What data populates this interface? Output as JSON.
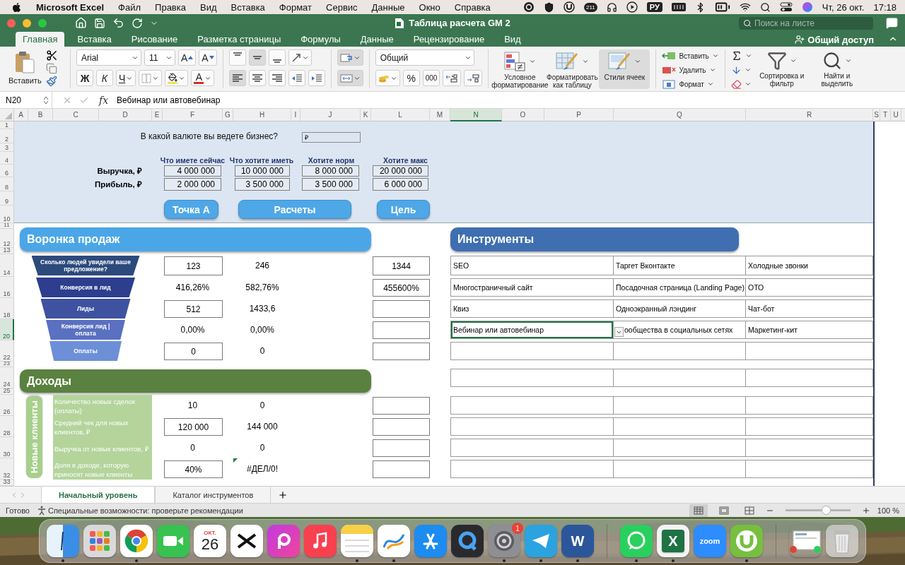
{
  "menubar": {
    "app": "Microsoft Excel",
    "menus": [
      "Файл",
      "Правка",
      "Вид",
      "Вставка",
      "Формат",
      "Сервис",
      "Данные",
      "Окно",
      "Справка"
    ],
    "notifications": "211",
    "input_source": "РУ",
    "date": "Чт, 26 окт.",
    "time": "17:18"
  },
  "window": {
    "title": "Таблица расчета GM 2",
    "search": {
      "placeholder": "Поиск на листе"
    }
  },
  "ribbon_tabs": [
    {
      "label": "Главная",
      "selected": true
    },
    {
      "label": "Вставка",
      "selected": false
    },
    {
      "label": "Рисование",
      "selected": false
    },
    {
      "label": "Разметка страницы",
      "selected": false
    },
    {
      "label": "Формулы",
      "selected": false
    },
    {
      "label": "Данные",
      "selected": false
    },
    {
      "label": "Рецензирование",
      "selected": false
    },
    {
      "label": "Вид",
      "selected": false
    }
  ],
  "share": "Общий доступ",
  "ribbon": {
    "paste": "Вставить",
    "font": {
      "name": "Arial",
      "size": "11",
      "grow": "A",
      "shrink": "A",
      "bold": "Ж",
      "italic": "К",
      "underline": "Ч",
      "font_color_letter": "A"
    },
    "vertical_align": [
      {
        "selected": false
      },
      {
        "selected": true
      },
      {
        "selected": false
      }
    ],
    "horizontal_align": [
      {
        "selected": true
      },
      {
        "selected": false
      },
      {
        "selected": false
      }
    ],
    "wrap_text": {
      "selected": true
    },
    "merge": {
      "selected": true
    },
    "number": {
      "format": "Общий",
      "percent": "%",
      "thousands": "000"
    },
    "styles": [
      {
        "kind": "conditional",
        "label": "Условное форматирование",
        "selected": false
      },
      {
        "kind": "table",
        "label": "Форматировать как таблицу",
        "selected": false
      },
      {
        "kind": "cell_styles",
        "label": "Стили ячеек",
        "selected": true
      }
    ],
    "cells": [
      {
        "kind": "insert",
        "label": "Вставить"
      },
      {
        "kind": "delete",
        "label": "Удалить"
      },
      {
        "kind": "format",
        "label": "Формат"
      }
    ],
    "editing": [
      {
        "kind": "sort",
        "label": "Сортировка и фильтр"
      },
      {
        "kind": "find",
        "label": "Найти и выделить"
      }
    ]
  },
  "formula_bar": {
    "name_box": "N20",
    "fx": "fx",
    "value": "Вебинар или автовебинар"
  },
  "columns": [
    {
      "label": "A",
      "selected": false
    },
    {
      "label": "B",
      "selected": false
    },
    {
      "label": "C",
      "selected": false
    },
    {
      "label": "D",
      "selected": false
    },
    {
      "label": "E",
      "selected": false
    },
    {
      "label": "F",
      "selected": false
    },
    {
      "label": "G",
      "selected": false
    },
    {
      "label": "H",
      "selected": false
    },
    {
      "label": "I",
      "selected": false
    },
    {
      "label": "J",
      "selected": false
    },
    {
      "label": "K",
      "selected": false
    },
    {
      "label": "L",
      "selected": false
    },
    {
      "label": "M",
      "selected": false
    },
    {
      "label": "N",
      "selected": true
    },
    {
      "label": "O",
      "selected": false
    },
    {
      "label": "P",
      "selected": false
    },
    {
      "label": "Q",
      "selected": false
    },
    {
      "label": "R",
      "selected": false
    },
    {
      "label": "S",
      "selected": false
    },
    {
      "label": "T",
      "selected": false
    },
    {
      "label": "U",
      "selected": false
    }
  ],
  "rows": [
    {
      "label": "1",
      "selected": false
    },
    {
      "label": "2",
      "selected": false
    },
    {
      "label": "3",
      "selected": false
    },
    {
      "label": "4",
      "selected": false
    },
    {
      "label": "6",
      "selected": false
    },
    {
      "label": "8",
      "selected": false
    },
    {
      "label": "9",
      "selected": false
    },
    {
      "label": "10",
      "selected": false
    },
    {
      "label": "11",
      "selected": false
    },
    {
      "label": "12",
      "selected": false
    },
    {
      "label": "13",
      "selected": false
    },
    {
      "label": "14",
      "selected": false
    },
    {
      "label": "16",
      "selected": false
    },
    {
      "label": "18",
      "selected": false
    },
    {
      "label": "20",
      "selected": true
    },
    {
      "label": "22",
      "selected": false
    },
    {
      "label": "23",
      "selected": false
    },
    {
      "label": "24",
      "selected": false
    },
    {
      "label": "25",
      "selected": false
    },
    {
      "label": "26",
      "selected": false
    },
    {
      "label": "28",
      "selected": false
    },
    {
      "label": "30",
      "selected": false
    },
    {
      "label": "32",
      "selected": false
    },
    {
      "label": "33",
      "selected": false
    }
  ],
  "sheet": {
    "currency": {
      "question": "В какой валюте вы ведете бизнес?",
      "value": "₽"
    },
    "scenarios": [
      "Что имете сейчас",
      "Что хотите иметь",
      "Хотите норм",
      "Хотите макс"
    ],
    "metrics": [
      {
        "label": "Выручка, ₽",
        "values": [
          "4 000 000",
          "10 000 000",
          "8 000 000",
          "20 000 000"
        ]
      },
      {
        "label": "Прибыль, ₽",
        "values": [
          "2 000 000",
          "3 500 000",
          "3 500 000",
          "6 000 000"
        ]
      }
    ],
    "nav_buttons": [
      "Точка А",
      "Расчеты",
      "Цель"
    ],
    "funnel": {
      "title": "Воронка продаж",
      "stages": [
        {
          "label": "Сколько людей увидели ваше предложение?",
          "kind": "input",
          "current": "123",
          "target": "246",
          "extra": "1344"
        },
        {
          "label": "Конверсия в лид",
          "kind": "calc",
          "current": "416,26%",
          "target": "582,76%",
          "extra": "455600%"
        },
        {
          "label": "Лиды",
          "kind": "input",
          "current": "512",
          "target": "1433,6"
        },
        {
          "label": "Конверсия лид | оплата",
          "kind": "calc",
          "current": "0,00%",
          "target": "0,00%"
        },
        {
          "label": "Оплаты",
          "kind": "input",
          "current": "0",
          "target": "0"
        }
      ]
    },
    "income": {
      "title": "Доходы",
      "group": "Новые клиенты",
      "rows": [
        {
          "label": "Количество новых сделок (оплаты)",
          "kind": "calc",
          "current": "10",
          "target": "0",
          "error": false
        },
        {
          "label": "Средний чек для новых клиентов, ₽",
          "kind": "input",
          "current": "120 000",
          "target": "144 000",
          "error": false
        },
        {
          "label": "Выручка от новых клиентов, ₽",
          "kind": "calc",
          "current": "0",
          "target": "0",
          "error": false
        },
        {
          "label": "Доля в доходе, которую приносят новые клиенты",
          "kind": "input",
          "current": "40%",
          "target": "#ДЕЛ/0!",
          "error": true
        }
      ]
    },
    "tools": {
      "title": "Инструменты",
      "rows": [
        [
          {
            "text": "SEO",
            "selected": false
          },
          {
            "text": "Таргет Вконтакте",
            "selected": false
          },
          {
            "text": "Холодные звонки",
            "selected": false
          }
        ],
        [
          {
            "text": "Многостраничный сайт",
            "selected": false
          },
          {
            "text": "Посадочная страница (Landing Page)",
            "selected": false
          },
          {
            "text": "ОТО",
            "selected": false
          }
        ],
        [
          {
            "text": "Квиз",
            "selected": false
          },
          {
            "text": "Одноэкранный лэндинг",
            "selected": false
          },
          {
            "text": "Чат-бот",
            "selected": false
          }
        ],
        [
          {
            "text": "Вебинар или автовебинар",
            "selected": true
          },
          {
            "text": "ообщества в социальных сетях",
            "selected": false
          },
          {
            "text": "Маркетинг-кит",
            "selected": false
          }
        ]
      ]
    }
  },
  "sheet_tabs": [
    {
      "label": "Начальный уровень",
      "selected": true
    },
    {
      "label": "Каталог инструментов",
      "selected": false
    }
  ],
  "status_bar": {
    "ready": "Готово",
    "accessibility": "Специальные возможности: проверьте рекомендации",
    "views": [
      {
        "selected": true
      },
      {
        "selected": false
      },
      {
        "selected": false
      }
    ],
    "zoom": {
      "level": 0.62,
      "label": "100 %"
    }
  },
  "dock": {
    "groups": [
      [
        {
          "kind": "finder",
          "running": true
        },
        {
          "kind": "launchpad",
          "running": false
        },
        {
          "kind": "chrome",
          "running": true
        },
        {
          "kind": "facetime",
          "running": false
        },
        {
          "kind": "calendar",
          "month": "ОКТ.",
          "day": "26",
          "running": false
        },
        {
          "kind": "capcut",
          "running": false
        },
        {
          "kind": "picsart",
          "running": false
        },
        {
          "kind": "music",
          "running": false
        },
        {
          "kind": "notes",
          "running": true
        },
        {
          "kind": "freeform",
          "running": true
        },
        {
          "kind": "appstore",
          "running": false
        },
        {
          "kind": "quicktime",
          "running": false
        },
        {
          "kind": "settings",
          "badge": "1",
          "running": true
        },
        {
          "kind": "telegram",
          "running": true
        },
        {
          "kind": "word",
          "letter": "W",
          "running": true
        }
      ],
      [
        {
          "kind": "whatsapp",
          "running": true
        },
        {
          "kind": "excel",
          "letter": "X",
          "running": true
        },
        {
          "kind": "zoom",
          "label": "zoom",
          "running": false
        },
        {
          "kind": "utorrent",
          "running": true
        }
      ],
      [
        {
          "kind": "stack",
          "running": false
        },
        {
          "kind": "trash",
          "running": false
        }
      ]
    ]
  }
}
